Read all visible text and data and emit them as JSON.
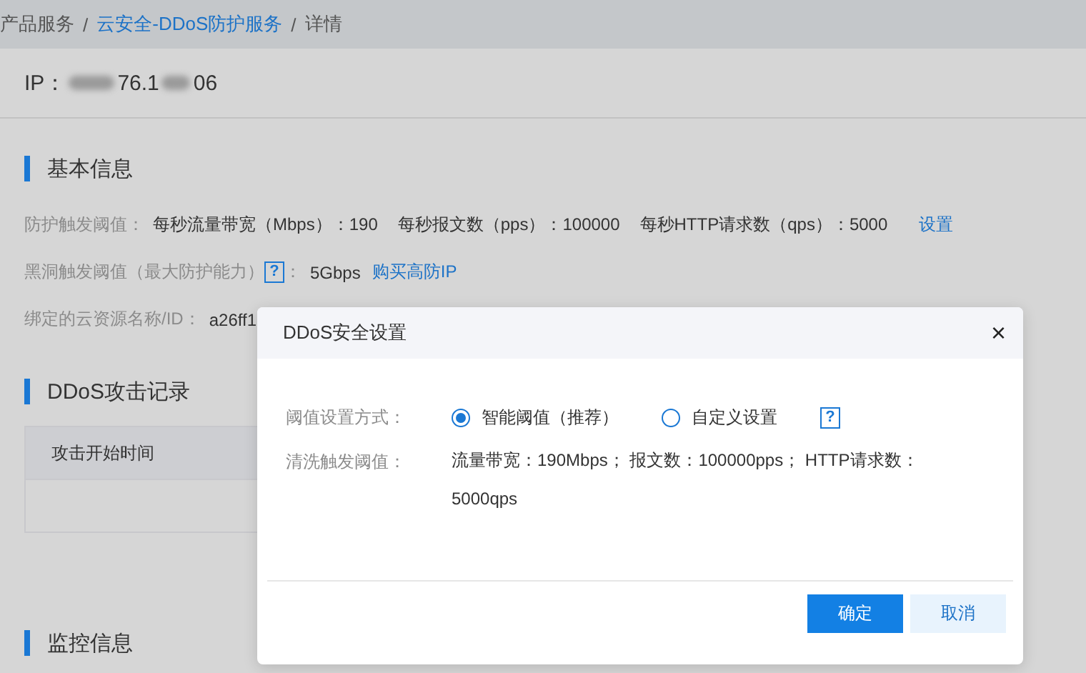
{
  "breadcrumb": [
    {
      "label": "产品服务",
      "link": false
    },
    {
      "label": "云安全-DDoS防护服务",
      "link": true
    },
    {
      "label": "详情",
      "link": false
    }
  ],
  "breadcrumb_separator": "/",
  "ip": {
    "label": "IP：",
    "value_visible": "76.1",
    "value_tail": "06"
  },
  "sections": [
    {
      "title": "基本信息"
    },
    {
      "title": "DDoS攻击记录"
    },
    {
      "title": "监控信息"
    }
  ],
  "basic_info": {
    "protect_label": "防护触发阈值：",
    "protect_items": [
      "每秒流量带宽（Mbps）：190",
      "每秒报文数（pps）：100000",
      "每秒HTTP请求数（qps）：5000"
    ],
    "protect_link": "设置",
    "blackhole_label": "黑洞触发阈值（最大防护能力）",
    "blackhole_help": "?",
    "blackhole_colon": "：",
    "blackhole_value": "5Gbps",
    "blackhole_link": "购买高防IP",
    "bound_label": "绑定的云资源名称/ID：",
    "bound_value": "a26ff1"
  },
  "attack_table": {
    "columns": [
      "攻击开始时间"
    ]
  },
  "dialog": {
    "title": "DDoS安全设置",
    "close": "×",
    "mode_label": "阈值设置方式：",
    "options": [
      {
        "label": "智能阈值（推荐）",
        "selected": true
      },
      {
        "label": "自定义设置",
        "selected": false
      }
    ],
    "help": "?",
    "clean_label": "清洗触发阈值：",
    "clean_value": "流量带宽：190Mbps；  报文数：100000pps；  HTTP请求数：5000qps",
    "buttons": [
      {
        "label": "确定",
        "kind": "primary"
      },
      {
        "label": "取消",
        "kind": "secondary"
      }
    ]
  }
}
